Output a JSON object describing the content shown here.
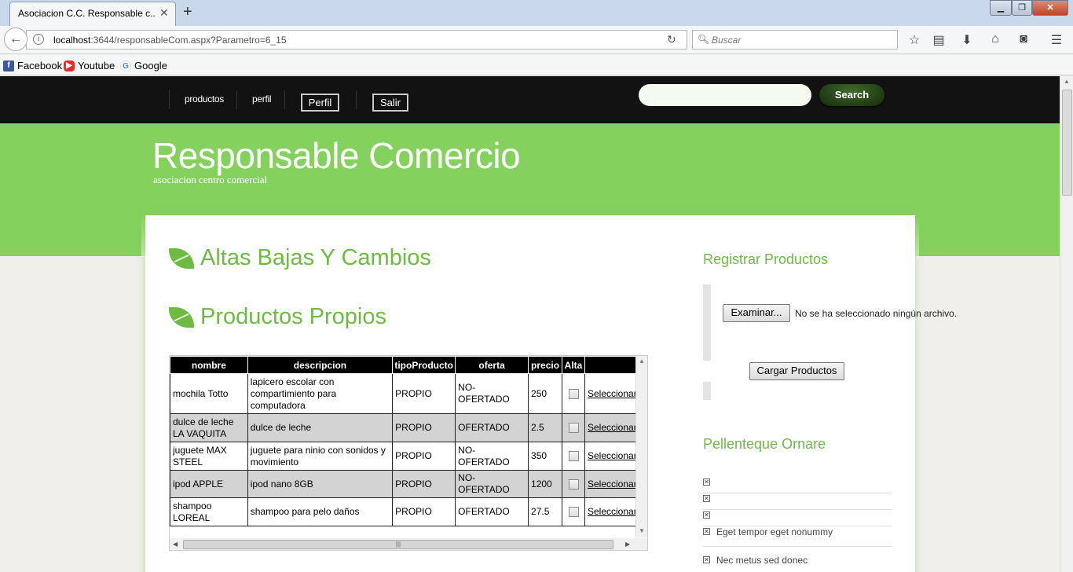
{
  "browser": {
    "tab_title": "Asociacion C.C. Responsable c...",
    "url_host": "localhost",
    "url_rest": ":3644/responsableCom.aspx?Parametro=6_15",
    "search_placeholder": "Buscar",
    "bookmarks": [
      "Facebook",
      "Youtube",
      "Google"
    ]
  },
  "nav": {
    "links": [
      "productos",
      "perfil"
    ],
    "buttons": [
      "Perfil",
      "Salir"
    ],
    "search_button": "Search"
  },
  "site": {
    "title": "Responsable Comercio",
    "subtitle": "asociacion centro comercial"
  },
  "main": {
    "heading1": "Altas Bajas Y Cambios",
    "heading2": "Productos Propios",
    "table": {
      "headers": [
        "nombre",
        "descripcion",
        "tipoProducto",
        "oferta",
        "precio",
        "Alta",
        ""
      ],
      "rows": [
        {
          "nombre": "mochila Totto",
          "descripcion": "lapicero escolar con compartimiento para computadora",
          "tipo": "PROPIO",
          "oferta": "NO-OFERTADO",
          "precio": "250",
          "link": "Seleccionar"
        },
        {
          "nombre": "dulce de leche LA VAQUITA",
          "descripcion": "dulce de leche",
          "tipo": "PROPIO",
          "oferta": "OFERTADO",
          "precio": "2.5",
          "link": "Seleccionar"
        },
        {
          "nombre": "juguete MAX STEEL",
          "descripcion": "juguete para ninio con sonidos y movimiento",
          "tipo": "PROPIO",
          "oferta": "NO-OFERTADO",
          "precio": "350",
          "link": "Seleccionar"
        },
        {
          "nombre": "ipod APPLE",
          "descripcion": "ipod nano 8GB",
          "tipo": "PROPIO",
          "oferta": "NO-OFERTADO",
          "precio": "1200",
          "link": "Seleccionar"
        },
        {
          "nombre": "shampoo LOREAL",
          "descripcion": "shampoo para pelo daños",
          "tipo": "PROPIO",
          "oferta": "OFERTADO",
          "precio": "27.5",
          "link": "Seleccionar"
        }
      ]
    }
  },
  "sidebar": {
    "register_heading": "Registrar Productos",
    "browse_button": "Examinar...",
    "file_status": "No se ha seleccionado ningún archivo.",
    "upload_button": "Cargar Productos",
    "list_heading": "Pellenteque Ornare",
    "list_items": [
      "",
      "",
      "",
      "Eget tempor eget nonummy",
      "Nec metus sed donec"
    ]
  }
}
